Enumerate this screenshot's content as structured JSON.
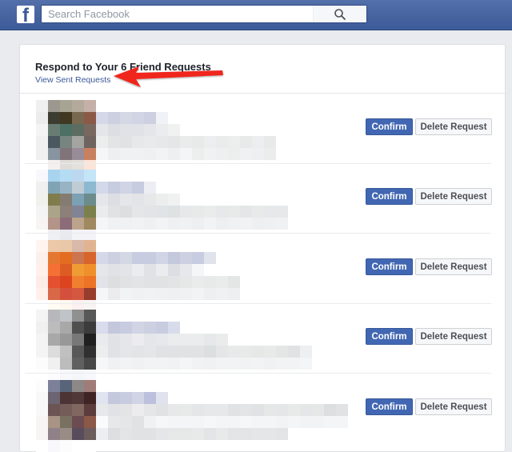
{
  "header": {
    "logo_glyph": "f",
    "logo_icon": "facebook-logo-icon",
    "search_placeholder": "Search Facebook",
    "search_value": "",
    "search_icon": "magnifier-icon",
    "brand_color": "#3b5998"
  },
  "main": {
    "title": "Respond to Your 6 Friend Requests",
    "view_sent_link": "View Sent Requests",
    "annotation": "red-arrow-pointing-to-view-sent-requests",
    "annotation_color": "#f0281e"
  },
  "requests": [
    {
      "name": "(pixelated)",
      "confirm_label": "Confirm",
      "delete_label": "Delete Request",
      "avatar_pixels": [
        [
          "#f0f0f0",
          "#9c9890",
          "#a8a494",
          "#b4aa9c",
          "#c4b0a8"
        ],
        [
          "#ececec",
          "#3c3c30",
          "#403820",
          "#786850",
          "#8c5848"
        ],
        [
          "#f4f4f4",
          "#687c74",
          "#4c7064",
          "#5c6c60",
          "#786860"
        ],
        [
          "#f0f0f0",
          "#4c5860",
          "#788480",
          "#a4a4a0",
          "#706460"
        ],
        [
          "#f0f0f0",
          "#8894a0",
          "#807478",
          "#988c98",
          "#c88060"
        ],
        [
          "#ffffff",
          "#f4f0ee",
          "#e0dcd8",
          "#e4e0dc",
          "#fce4d8"
        ]
      ],
      "text_lines": [
        {
          "blocks": [
            "#d4d8e8",
            "#ccd0e0",
            "#d4d8e4",
            "#d0d4e4",
            "#ccd0e0",
            "#f0f2f8"
          ]
        },
        {
          "blocks": [
            "#e4e6ea",
            "#dcdee4",
            "#e0e2e8",
            "#e0e2e8",
            "#e4e6ea",
            "#eaecee",
            "#f0f2f2"
          ]
        },
        {
          "blocks": [
            "#eceeee",
            "#e2e4e6",
            "#e0e2e4",
            "#e6e8ea",
            "#e8eaec",
            "#e6e8ea",
            "#e4e6e8",
            "#eaecec",
            "#e8eaea",
            "#ecedee",
            "#eaecec",
            "#eceeee",
            "#e8eaea",
            "#ecedee",
            "#e8eaea"
          ]
        },
        {
          "blocks": [
            "#f4f6f8",
            "#eeeff0",
            "#f0f1f2",
            "#f0f1f2",
            "#eff0f2",
            "#f2f3f4",
            "#eeeff0",
            "#f4f5f6",
            "#eceeee",
            "#f0f1f2",
            "#eeeff0",
            "#eceeee",
            "#f0f1f2",
            "#eeeff0",
            "#ebecec"
          ]
        }
      ]
    },
    {
      "name": "(pixelated)",
      "confirm_label": "Confirm",
      "delete_label": "Delete Request",
      "avatar_pixels": [
        [
          "#f8f8fc",
          "#a8d4f0",
          "#b4dcf4",
          "#bcd8f0",
          "#c4e4f8"
        ],
        [
          "#f0f0f0",
          "#80a4b4",
          "#98b4c4",
          "#c0ccd4",
          "#8cb8d0"
        ],
        [
          "#f0f0ec",
          "#807c4c",
          "#847c70",
          "#7ca0b4",
          "#6c8c8c"
        ],
        [
          "#f4f4f4",
          "#aca488",
          "#8c8078",
          "#808494",
          "#7c804c"
        ],
        [
          "#f8f4f4",
          "#b49488",
          "#8c6c78",
          "#bca48c",
          "#a08860"
        ],
        [
          "#ffffff",
          "#f0f0f4",
          "#e8eaf0",
          "#f4f4f8",
          "#f4f4f8"
        ]
      ],
      "text_lines": [
        {
          "blocks": [
            "#d4d8e8",
            "#c8cce0",
            "#d0d4e4",
            "#c8cce0",
            "#eceef4"
          ]
        },
        {
          "blocks": [
            "#e4e6ea",
            "#dcdee4",
            "#e4e6ea",
            "#e2e4e8",
            "#e6e8ea",
            "#eceeee",
            "#f0f2f2"
          ]
        },
        {
          "blocks": [
            "#eaecee",
            "#e0e2e4",
            "#dcdee0",
            "#e4e6e8",
            "#e2e4e6",
            "#e0e4e6",
            "#dee2e2",
            "#e6e8ea",
            "#e8eaea",
            "#eaecec",
            "#e6e8ea",
            "#e8eaea",
            "#e4e6e8",
            "#e8eaea",
            "#e6e8ea",
            "#e6e8ea"
          ]
        },
        {
          "blocks": [
            "#f4f6f8",
            "#f0f1f2",
            "#f0f1f2",
            "#f1f2f3",
            "#eff0f2",
            "#f2f3f4",
            "#eff0f1",
            "#f0f1f2",
            "#eeeff0",
            "#f2f3f4",
            "#eeeff0",
            "#f0f1f2",
            "#f1f2f3",
            "#eeeff0",
            "#eff0f1",
            "#f0f1f2"
          ]
        }
      ]
    },
    {
      "name": "(pixelated)",
      "confirm_label": "Confirm",
      "delete_label": "Delete Request",
      "avatar_pixels": [
        [
          "#fff4f0",
          "#ecc8a8",
          "#e8c8a8",
          "#d8b8a8",
          "#e0b490"
        ],
        [
          "#fcf0ec",
          "#e47830",
          "#e46c20",
          "#cc7450",
          "#d8642c"
        ],
        [
          "#fff0ec",
          "#f47034",
          "#dc5c24",
          "#f09c34",
          "#f0902c"
        ],
        [
          "#fcece8",
          "#e45030",
          "#dc4420",
          "#f08030",
          "#ec7424"
        ],
        [
          "#fff0ec",
          "#d86848",
          "#d4503c",
          "#d45840",
          "#983c2c"
        ],
        [
          "#ffffff",
          "#fffcf4",
          "#fff8f0",
          "#fcf0f0",
          "#f8f4f4"
        ]
      ],
      "text_lines": [
        {
          "blocks": [
            "#d4d8e8",
            "#ccd0e0",
            "#d4d8e4",
            "#c8cce0",
            "#c8cce0",
            "#d0d4e4",
            "#c4c8dc",
            "#ccd0e0",
            "#c8cce0",
            "#e0e2ec"
          ]
        },
        {
          "blocks": [
            "#e4e6ea",
            "#e0e2e6",
            "#e2e4e8",
            "#eaecee",
            "#e0e2e6",
            "#eaecee",
            "#dcdee4",
            "#e6e8ec",
            "#f4f6f8"
          ]
        },
        {
          "blocks": [
            "#e0e4e8",
            "#dcdee0",
            "#e0e2e4",
            "#e2e4e6",
            "#e0e2e4",
            "#e0e2e4",
            "#e2e4e6",
            "#e6e8e8",
            "#eaecec",
            "#e8eaea",
            "#eaecec",
            "#e4e6e6"
          ]
        },
        {
          "blocks": [
            "#f4f6f8",
            "#ececee",
            "#f2f3f4",
            "#f0f1f2",
            "#f1f2f3",
            "#f0f1f2",
            "#eff0f1",
            "#f0f1f2",
            "#f2f3f4",
            "#eeeff0",
            "#f0f1f2",
            "#eeeff0"
          ]
        }
      ]
    },
    {
      "name": "(pixelated)",
      "confirm_label": "Confirm",
      "delete_label": "Delete Request",
      "avatar_pixels": [
        [
          "#f4f4f4",
          "#b8b8bc",
          "#c0c4c8",
          "#909090",
          "#585858"
        ],
        [
          "#f0f0f0",
          "#bcbcbc",
          "#a8a8a8",
          "#505050",
          "#3c3c3c"
        ],
        [
          "#f4f4f4",
          "#a8a8a8",
          "#989898",
          "#787878",
          "#202020"
        ],
        [
          "#f4f4f4",
          "#dcdcdc",
          "#c0c0c0",
          "#585858",
          "#303030"
        ],
        [
          "#fcfcfc",
          "#f0f0f0",
          "#bcbcbc",
          "#606060",
          "#484848"
        ],
        [
          "#ffffff",
          "#fcfcfc",
          "#f8f8fc",
          "#f4f6f8",
          "#f8f8fc"
        ]
      ],
      "text_lines": [
        {
          "blocks": [
            "#d8dcec",
            "#c4c8dc",
            "#c8cce0",
            "#d0d4e4",
            "#ccd0e0",
            "#c8cce0",
            "#d8dcea"
          ]
        },
        {
          "blocks": [
            "#e8eaec",
            "#e0e2e6",
            "#e4e6ea",
            "#ececee",
            "#e4e6ea",
            "#e6e8ec",
            "#eaecee",
            "#eaecee",
            "#eaecee",
            "#e6e8ea",
            "#eaecec"
          ]
        },
        {
          "blocks": [
            "#eceeee",
            "#e0e2e6",
            "#e4e6e8",
            "#e2e4e6",
            "#e4e6e8",
            "#e0e2e4",
            "#e0e2e4",
            "#e0e2e4",
            "#e0e2e4",
            "#dcdfe0",
            "#e4e6e8",
            "#e8eaea",
            "#e8eaea",
            "#e6e8e8",
            "#e8eaea",
            "#e4e6e6",
            "#e0e2e4",
            "#eeeff0"
          ]
        },
        {
          "blocks": [
            "#f6f7f8",
            "#f0f1f2",
            "#f2f3f4",
            "#f0f1f2",
            "#f2f3f4",
            "#f2f3f4",
            "#f1f2f3",
            "#f4f5f6",
            "#f1f2f3",
            "#f0f1f2",
            "#f2f3f4",
            "#f2f3f4",
            "#f1f2f3",
            "#f2f3f4",
            "#f0f1f2",
            "#f2f3f4",
            "#f2f3f4",
            "#f4f5f6"
          ]
        }
      ]
    },
    {
      "name": "(pixelated)",
      "confirm_label": "Confirm",
      "delete_label": "Delete Request",
      "avatar_pixels": [
        [
          "#fcfcfc",
          "#7c8098",
          "#586478",
          "#8c8888",
          "#a07c78"
        ],
        [
          "#f8f8f8",
          "#6c6470",
          "#4c3434",
          "#503838",
          "#402424"
        ],
        [
          "#f8f8f8",
          "#6c5454",
          "#745c58",
          "#806860",
          "#5c3c3c"
        ],
        [
          "#f8f4f4",
          "#a89484",
          "#787060",
          "#6c4c50",
          "#8c5848"
        ],
        [
          "#f8f4f4",
          "#908088",
          "#988c84",
          "#584c5c",
          "#6c5c5c"
        ],
        [
          "#ffffff",
          "#f8f8fc",
          "#fcfcfc",
          "#ffffff",
          "#ffffff"
        ]
      ],
      "text_lines": [
        {
          "blocks": [
            "#e0e4f0",
            "#c4c8dc",
            "#c8cce0",
            "#d0d4e4",
            "#bcc0dc",
            "#e0e2ee"
          ]
        },
        {
          "blocks": [
            "#e6e8ea",
            "#e0e2e6",
            "#e2e4e6",
            "#ececee",
            "#e4e6e8",
            "#e0e2e4",
            "#e6e8ea",
            "#e8eaea",
            "#e4e6e8",
            "#e6e8ea",
            "#e6e8ea",
            "#e0e2e4",
            "#e2e4e6",
            "#e0e2e4",
            "#e6e8e8",
            "#e4e6e8",
            "#e8eaea",
            "#e4e6e8",
            "#e6e8e8",
            "#dcdfe0",
            "#e0e2e4"
          ]
        },
        {
          "blocks": [
            "#fafbfc",
            "#e6e8ea",
            "#e4e6e8",
            "#e0e2e4",
            "#f0f1f2",
            "#f6f7f8",
            "#f4f5f6",
            "#f4f5f6",
            "#f4f5f6",
            "#f6f7f8",
            "#f4f5f6",
            "#f4f5f6",
            "#f6f7f8",
            "#f4f5f6",
            "#f4f5f6",
            "#f2f3f4",
            "#f4f5f6",
            "#f2f3f4",
            "#f2f3f4",
            "#f4f5f6",
            "#f4f5f6"
          ]
        },
        {
          "blocks": [
            "#eceef2",
            "#dcdee0",
            "#e2e4e6",
            "#e0e2e4",
            "#e0e2e4",
            "#e4e6e8",
            "#e6e8e8",
            "#e6e8e8",
            "#e8eaea",
            "#e2e4e6",
            "#e8eaea",
            "#e2e4e6",
            "#e2e4e6",
            "#e4e6e8",
            "#e4e6e8",
            "#e2e4e6"
          ]
        }
      ]
    }
  ]
}
